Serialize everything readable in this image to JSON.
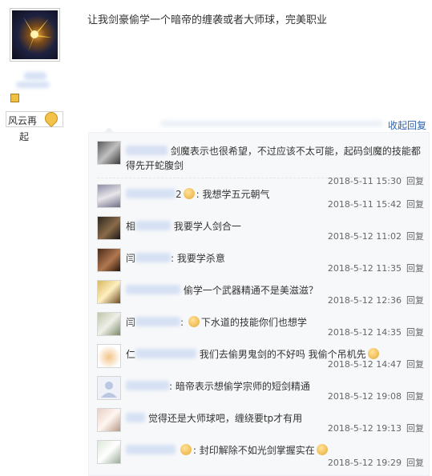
{
  "post": {
    "content": "让我剑豪偷学一个暗帝的缠袭或者大师球，完美职业",
    "author_title_line1": "风云再",
    "author_title_line2": "起"
  },
  "retract_label": "收起回复",
  "reply_button_label": "回复",
  "replies": [
    {
      "text_line1": "剑魔表示也很希望，不过应该不太可能，起码剑魔的技能都",
      "text_line2": "得先开蛇腹剑",
      "time": "2018-5-11 15:30",
      "avatar": "dark-knight"
    },
    {
      "prefix": "2",
      "text": ": 我想学五元朝气",
      "time": "2018-5-11 15:42",
      "avatar": "anime-girl"
    },
    {
      "prefix": "相",
      "text": "我要学人剑合一",
      "time": "2018-5-12 11:02",
      "avatar": "warrior"
    },
    {
      "prefix": "闫",
      "text": ": 我要学杀意",
      "time": "2018-5-12 11:35",
      "avatar": "brown-portrait"
    },
    {
      "text": "偷学一个武器精通不是美滋滋？",
      "time": "2018-5-12 12:36",
      "avatar": "blond-character"
    },
    {
      "prefix": "闫",
      "text": "下水道的技能你们也想学",
      "time": "2018-5-12 14:35",
      "avatar": "anime-boy"
    },
    {
      "prefix": "仁",
      "text": "我们去偷男鬼剑的不好吗 我偷个吊机先",
      "time": "2018-5-12 14:47",
      "avatar": "cartoon-cat"
    },
    {
      "text": ": 暗帝表示想偷学宗师的短剑精通",
      "time": "2018-5-12 19:08",
      "avatar": "default-user"
    },
    {
      "text": "觉得还是大师球吧，缠绕要tp才有用",
      "time": "2018-5-12 19:13",
      "avatar": "anime-pink"
    },
    {
      "text": "封印解除不如光剑掌握实在",
      "time": "2018-5-12 19:29",
      "avatar": "sketch-figure"
    }
  ],
  "colors": {
    "link": "#2d64b3",
    "panel_bg": "#f7f8fa"
  }
}
